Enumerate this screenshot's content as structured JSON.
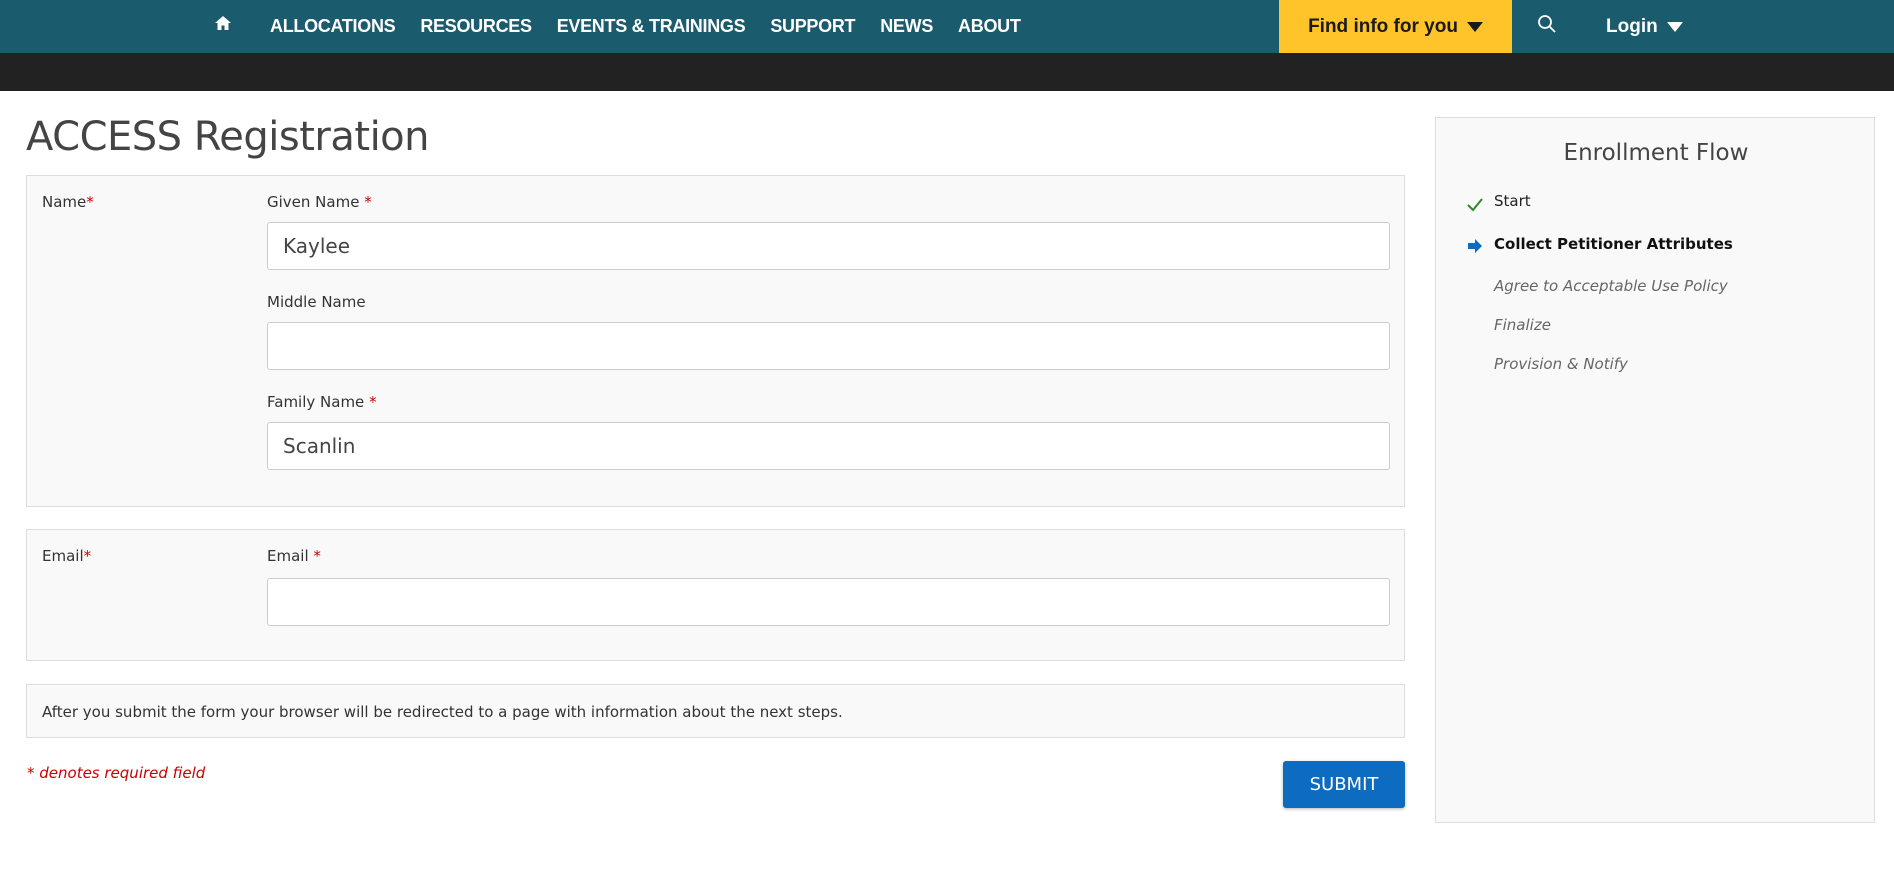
{
  "nav": {
    "links": [
      "ALLOCATIONS",
      "RESOURCES",
      "EVENTS & TRAININGS",
      "SUPPORT",
      "NEWS",
      "ABOUT"
    ],
    "find_info": "Find info for you",
    "login": "Login",
    "colors": {
      "bar": "#1a5b6e",
      "accent": "#ffc42a",
      "dark": "#222222"
    }
  },
  "page": {
    "title": "ACCESS Registration"
  },
  "form": {
    "name_row_label": "Name",
    "given_name_label": "Given Name",
    "given_name_value": "Kaylee",
    "middle_name_label": "Middle Name",
    "middle_name_value": "",
    "family_name_label": "Family Name",
    "family_name_value": "Scanlin",
    "email_row_label": "Email",
    "email_label": "Email",
    "email_value": "",
    "required_mark": "*",
    "note": "After you submit the form your browser will be redirected to a page with information about the next steps.",
    "required_note": "* denotes required field",
    "submit_label": "SUBMIT"
  },
  "sidebar": {
    "title": "Enrollment Flow",
    "steps": [
      {
        "label": "Start",
        "state": "done"
      },
      {
        "label": "Collect Petitioner Attributes",
        "state": "current"
      },
      {
        "label": "Agree to Acceptable Use Policy",
        "state": "future"
      },
      {
        "label": "Finalize",
        "state": "future"
      },
      {
        "label": "Provision & Notify",
        "state": "future"
      }
    ]
  }
}
